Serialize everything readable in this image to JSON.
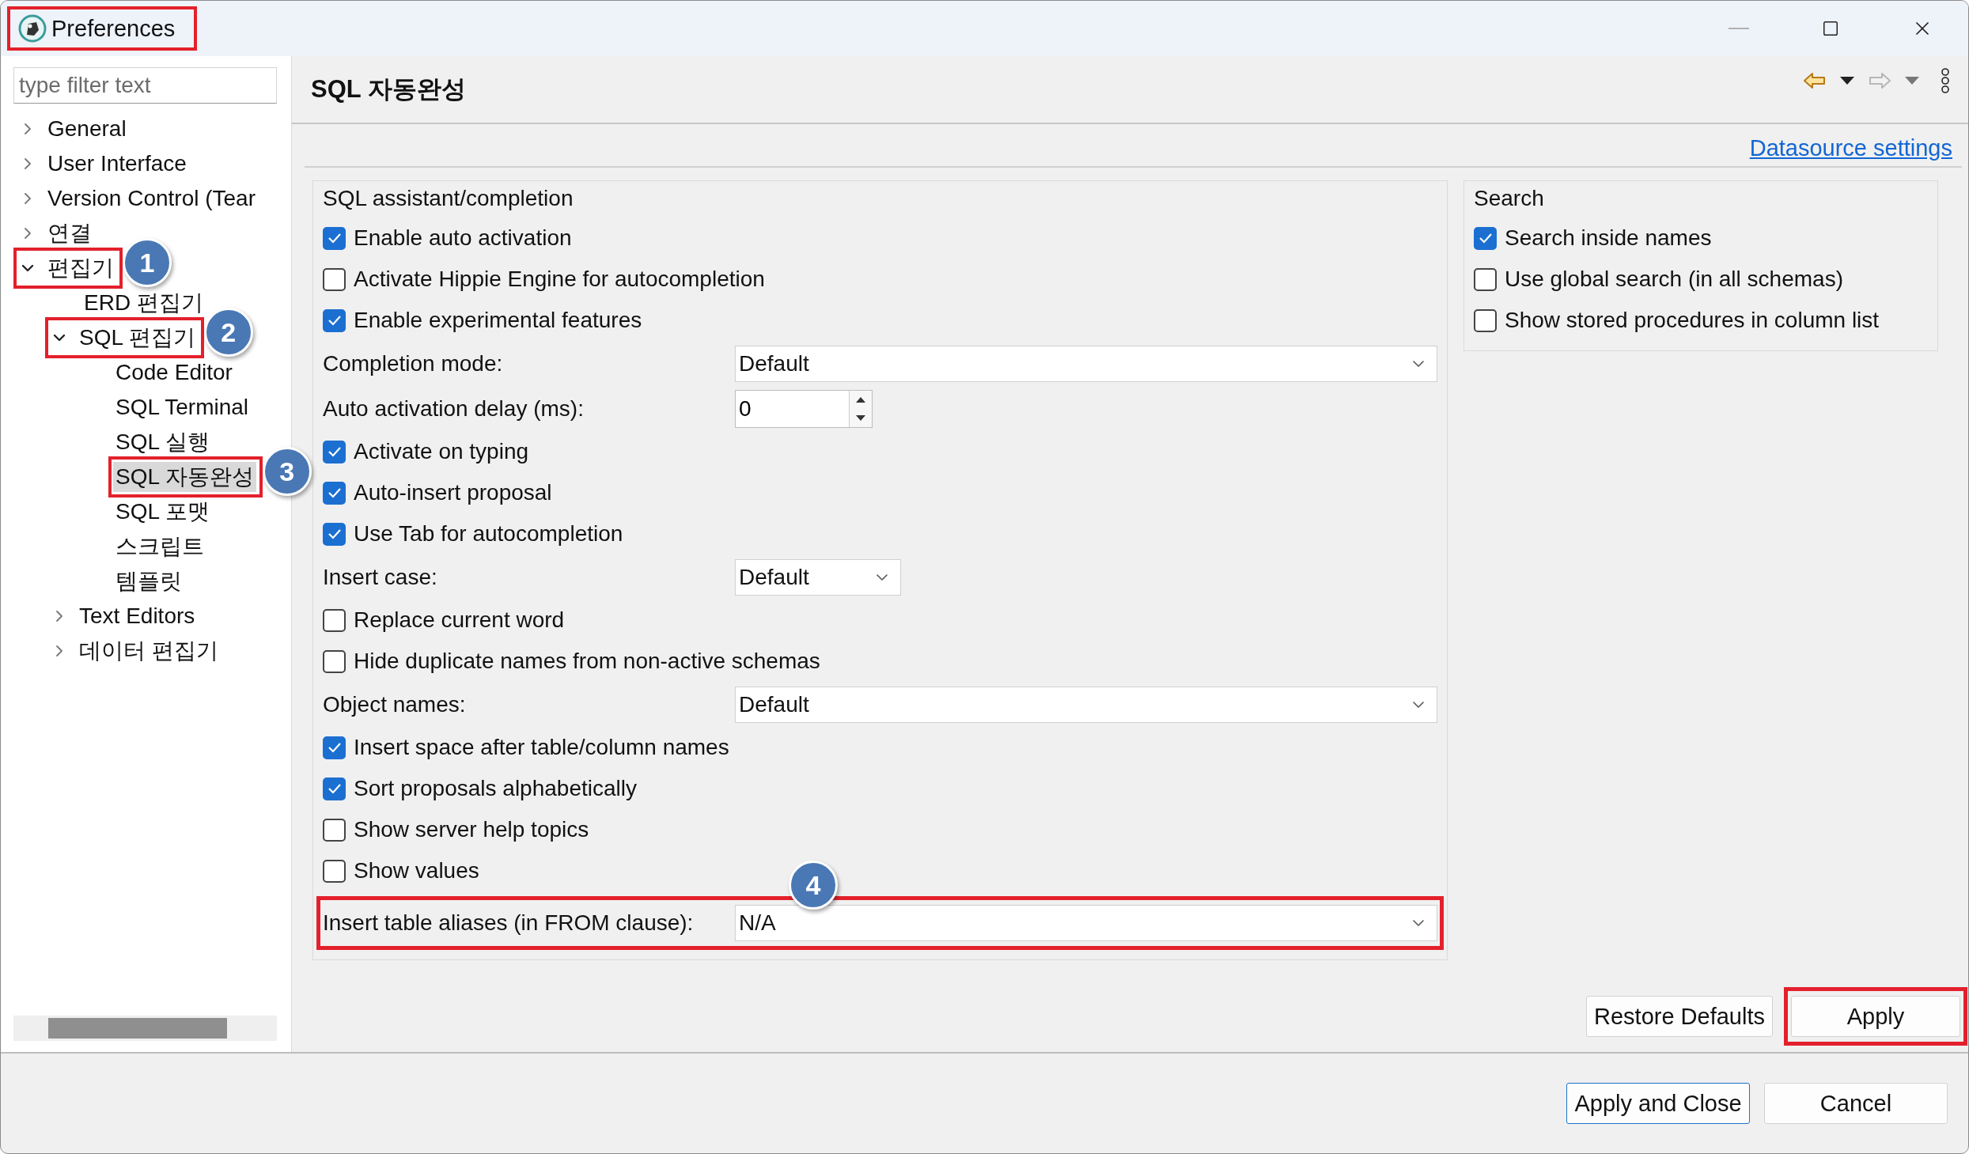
{
  "window": {
    "title": "Preferences",
    "highlighted": true
  },
  "filter": {
    "placeholder": "type filter text"
  },
  "tree": [
    {
      "label": "General",
      "expanded": false,
      "selected": false
    },
    {
      "label": "User Interface",
      "expanded": false,
      "selected": false
    },
    {
      "label": "Version Control (Tear",
      "expanded": false,
      "selected": false
    },
    {
      "label": "연결",
      "expanded": false,
      "selected": false
    },
    {
      "label": "편집기",
      "expanded": true,
      "selected": false,
      "highlighted": true,
      "callout": "1",
      "children": [
        {
          "label": "ERD 편집기",
          "selected": false
        },
        {
          "label": "SQL 편집기",
          "expanded": true,
          "selected": false,
          "highlighted": true,
          "callout": "2",
          "children": [
            {
              "label": "Code Editor",
              "selected": false
            },
            {
              "label": "SQL Terminal",
              "selected": false
            },
            {
              "label": "SQL 실행",
              "selected": false
            },
            {
              "label": "SQL 자동완성",
              "selected": true,
              "highlighted": true,
              "callout": "3"
            },
            {
              "label": "SQL 포맷",
              "selected": false
            },
            {
              "label": "스크립트",
              "selected": false
            },
            {
              "label": "템플릿",
              "selected": false
            }
          ]
        },
        {
          "label": "Text Editors",
          "expanded": false,
          "selected": false
        },
        {
          "label": "데이터 편집기",
          "expanded": false,
          "selected": false
        }
      ]
    }
  ],
  "page": {
    "title": "SQL 자동완성",
    "toolbar": [
      {
        "kind": "back",
        "disabled": false
      },
      {
        "kind": "forward",
        "disabled": true
      }
    ],
    "link": "Datasource settings"
  },
  "assistant_group": {
    "title": "SQL assistant/completion",
    "rows": [
      {
        "kind": "checkbox",
        "label": "Enable auto activation",
        "checked": true
      },
      {
        "kind": "checkbox",
        "label": "Activate Hippie Engine for autocompletion",
        "checked": false
      },
      {
        "kind": "checkbox",
        "label": "Enable experimental features",
        "checked": true
      },
      {
        "kind": "select",
        "label": "Completion mode:",
        "value": "Default",
        "wide": true
      },
      {
        "kind": "spinner",
        "label": "Auto activation delay (ms):",
        "value": "0"
      },
      {
        "kind": "checkbox",
        "label": "Activate on typing",
        "checked": true
      },
      {
        "kind": "checkbox",
        "label": "Auto-insert proposal",
        "checked": true
      },
      {
        "kind": "checkbox",
        "label": "Use Tab for autocompletion",
        "checked": true
      },
      {
        "kind": "select",
        "label": "Insert case:",
        "value": "Default",
        "wide": false
      },
      {
        "kind": "checkbox",
        "label": "Replace current word",
        "checked": false
      },
      {
        "kind": "checkbox",
        "label": "Hide duplicate names from non-active schemas",
        "checked": false
      },
      {
        "kind": "select",
        "label": "Object names:",
        "value": "Default",
        "wide": true
      },
      {
        "kind": "checkbox",
        "label": "Insert space after table/column names",
        "checked": true
      },
      {
        "kind": "checkbox",
        "label": "Sort proposals alphabetically",
        "checked": true
      },
      {
        "kind": "checkbox",
        "label": "Show server help topics",
        "checked": false
      },
      {
        "kind": "checkbox",
        "label": "Show values",
        "checked": false
      },
      {
        "kind": "select",
        "label": "Insert table aliases (in FROM clause):",
        "value": "N/A",
        "wide": true,
        "highlighted": true,
        "callout": "4"
      }
    ]
  },
  "search_group": {
    "title": "Search",
    "rows": [
      {
        "kind": "checkbox",
        "label": "Search inside names",
        "checked": true
      },
      {
        "kind": "checkbox",
        "label": "Use global search (in all schemas)",
        "checked": false
      },
      {
        "kind": "checkbox",
        "label": "Show stored procedures in column list",
        "checked": false
      }
    ]
  },
  "buttons": [
    {
      "label": "Restore Defaults",
      "default": false,
      "highlighted": false
    },
    {
      "label": "Apply",
      "default": false,
      "highlighted": true
    }
  ],
  "footer_buttons": [
    {
      "label": "Apply and Close",
      "default": true
    },
    {
      "label": "Cancel",
      "default": false
    }
  ]
}
